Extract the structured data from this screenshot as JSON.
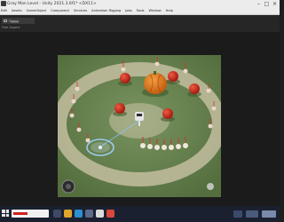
{
  "window": {
    "title": "Gray Man Level - Unity 2021.3.6f1* <DX11>",
    "controls": [
      "–",
      "□",
      "×"
    ]
  },
  "menu": {
    "items": [
      "Edit",
      "Assets",
      "GameObject",
      "Component",
      "Services",
      "Animation Rigging",
      "Jobs",
      "Tools",
      "Window",
      "Help"
    ]
  },
  "playbar": {
    "play": "▶",
    "pause": "❚❚",
    "step": "▶|"
  },
  "toolbar": {
    "view_tab": "Game",
    "ratio": "Free Aspect",
    "scale_label": "Scale"
  },
  "scene": {
    "grass_color": "#6f8a57",
    "ring_color": "#c9c2a5",
    "fort_color": "#3e4a30",
    "apple_color": "#c8281e",
    "pumpkin_color": "#e67a18",
    "selection_ring_color": "#9fd4ff",
    "icons": [
      "player-character-icon",
      "apple-tree-icon",
      "pumpkin-icon",
      "soldier-icon",
      "selection-ring-icon",
      "minimap-icon"
    ]
  },
  "taskbar": {
    "icons": [
      "start-icon",
      "search-box",
      "task-view-icon",
      "explorer-icon",
      "edge-icon",
      "store-icon",
      "unity-icon",
      "chrome-icon",
      "tray-icons"
    ]
  }
}
